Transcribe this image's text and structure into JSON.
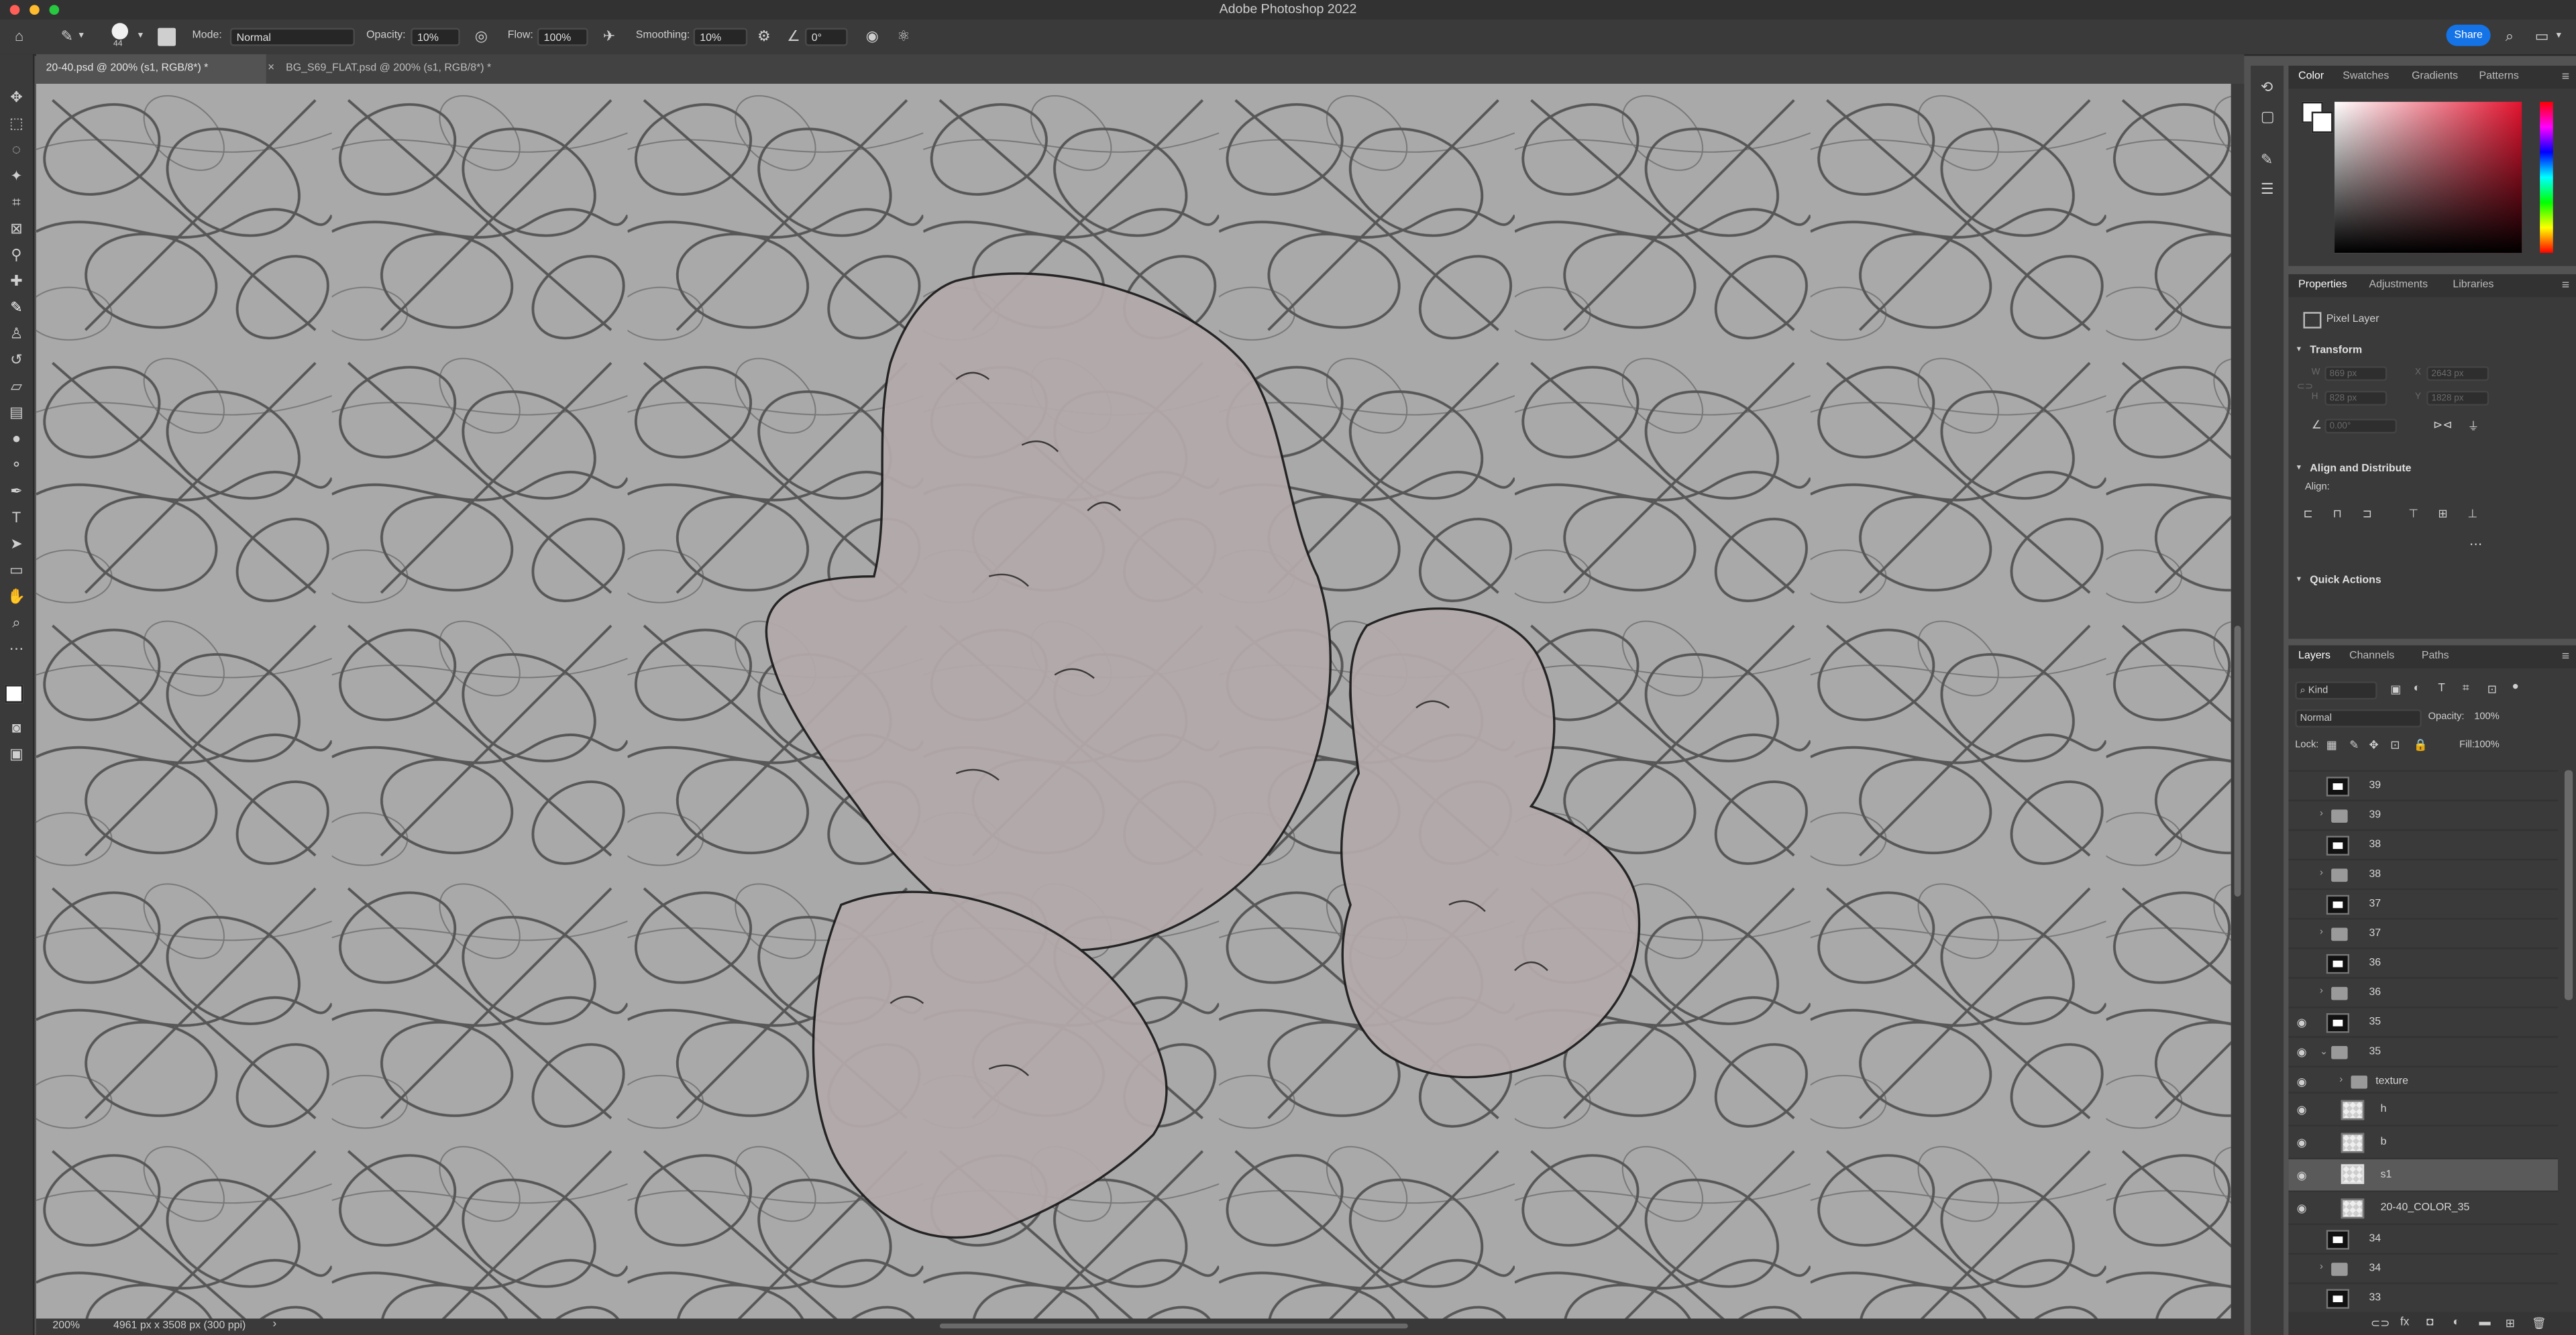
{
  "window": {
    "title": "Adobe Photoshop 2022"
  },
  "options_bar": {
    "brush_size": "44",
    "mode_label": "Mode:",
    "mode_value": "Normal",
    "opacity_label": "Opacity:",
    "opacity_value": "10%",
    "flow_label": "Flow:",
    "flow_value": "100%",
    "smoothing_label": "Smoothing:",
    "smoothing_value": "10%",
    "angle_value": "0°",
    "share_label": "Share"
  },
  "tabs": [
    {
      "label": "20-40.psd @ 200% (s1, RGB/8*) *",
      "active": true
    },
    {
      "label": "BG_S69_FLAT.psd @ 200% (s1, RGB/8*) *",
      "active": false
    }
  ],
  "status_bar": {
    "zoom": "200%",
    "doc_info": "4961 px x 3508 px (300 ppi)"
  },
  "color_panel": {
    "tabs": [
      "Color",
      "Swatches",
      "Gradients",
      "Patterns"
    ]
  },
  "properties_panel": {
    "tabs": [
      "Properties",
      "Adjustments",
      "Libraries"
    ],
    "layer_type": "Pixel Layer",
    "transform_label": "Transform",
    "w_label": "W",
    "w_value": "869 px",
    "x_label": "X",
    "x_value": "2643 px",
    "h_label": "H",
    "h_value": "828 px",
    "y_label": "Y",
    "y_value": "1828 px",
    "angle_value": "0.00°",
    "align_label": "Align and Distribute",
    "align_sub": "Align:",
    "quick_actions_label": "Quick Actions"
  },
  "layers_panel": {
    "tabs": [
      "Layers",
      "Channels",
      "Paths"
    ],
    "filter_label": "Kind",
    "blend_mode": "Normal",
    "opacity_label": "Opacity:",
    "opacity_value": "100%",
    "lock_label": "Lock:",
    "fill_label": "Fill:",
    "fill_value": "100%",
    "layers": [
      {
        "name": "39",
        "kind": "layer",
        "visible": false
      },
      {
        "name": "39",
        "kind": "group",
        "visible": false
      },
      {
        "name": "38",
        "kind": "layer",
        "visible": false
      },
      {
        "name": "38",
        "kind": "group",
        "visible": false
      },
      {
        "name": "37",
        "kind": "layer",
        "visible": false
      },
      {
        "name": "37",
        "kind": "group",
        "visible": false
      },
      {
        "name": "36",
        "kind": "layer",
        "visible": false
      },
      {
        "name": "36",
        "kind": "group",
        "visible": false
      },
      {
        "name": "35",
        "kind": "layer",
        "visible": true
      },
      {
        "name": "35",
        "kind": "group-open",
        "visible": true
      },
      {
        "name": "texture",
        "kind": "subgroup",
        "visible": true
      },
      {
        "name": "h",
        "kind": "pixel",
        "visible": true
      },
      {
        "name": "b",
        "kind": "pixel",
        "visible": true
      },
      {
        "name": "s1",
        "kind": "pixel",
        "visible": true,
        "selected": true
      },
      {
        "name": "20-40_COLOR_35",
        "kind": "pixel",
        "visible": true
      },
      {
        "name": "34",
        "kind": "layer",
        "visible": false
      },
      {
        "name": "34",
        "kind": "group",
        "visible": false
      },
      {
        "name": "33",
        "kind": "layer",
        "visible": false
      }
    ]
  },
  "colors": {
    "accent": "#1473e6",
    "canvas_tint": "#b3a9ab"
  }
}
